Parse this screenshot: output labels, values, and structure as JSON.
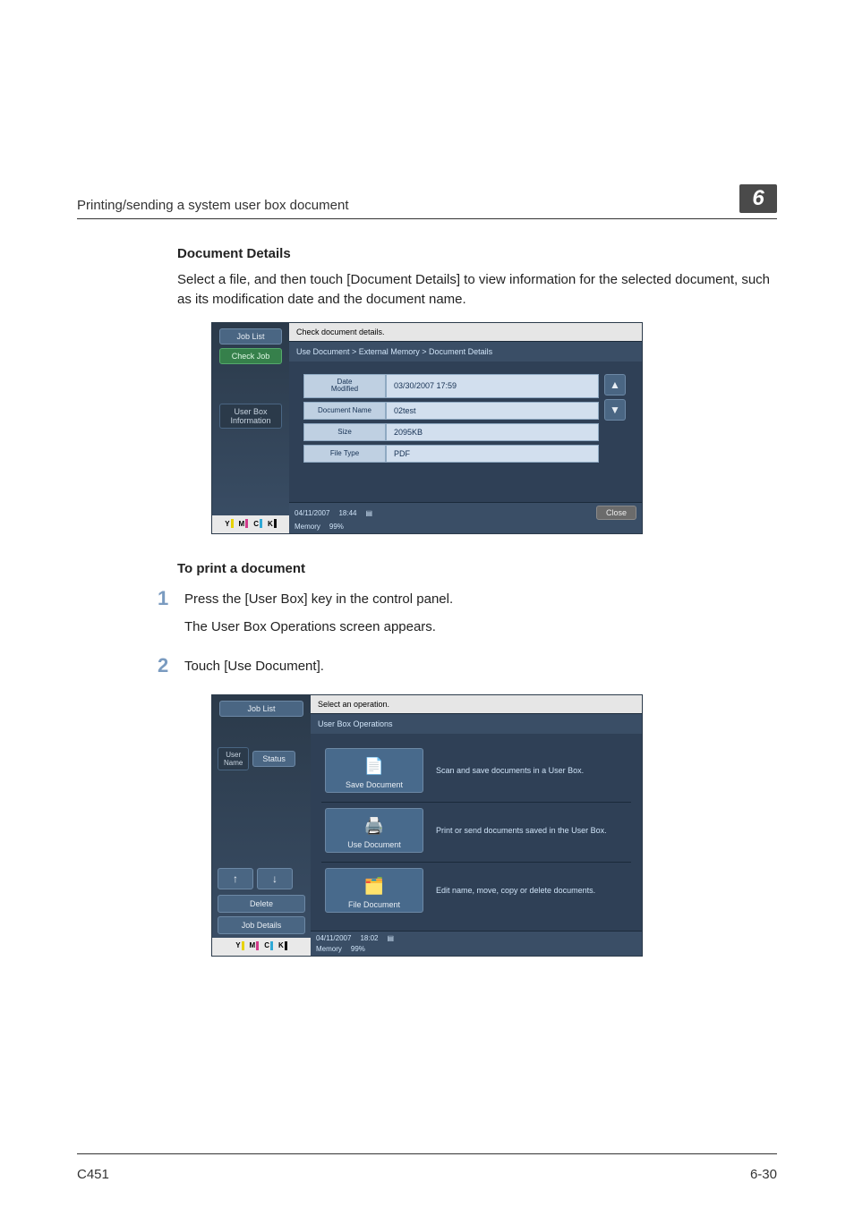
{
  "header": {
    "title": "Printing/sending a system user box document",
    "chapter": "6"
  },
  "section_title": "Document Details",
  "section_para": "Select a file, and then touch [Document Details] to view information for the selected document, such as its modification date and the document name.",
  "ss1": {
    "left": {
      "job_list": "Job List",
      "check_job": "Check Job",
      "user_box_info": "User Box\nInformation"
    },
    "titlebar": "Check document details.",
    "breadcrumb": "Use Document > External Memory > Document Details",
    "fields": [
      {
        "label": "Date\nModified",
        "value": "03/30/2007 17:59"
      },
      {
        "label": "Document Name",
        "value": "02test"
      },
      {
        "label": "Size",
        "value": "2095KB"
      },
      {
        "label": "File Type",
        "value": "PDF"
      }
    ],
    "close": "Close",
    "status": {
      "date": "04/11/2007",
      "time": "18:44",
      "memory_label": "Memory",
      "memory_value": "99%"
    },
    "toner": [
      "Y",
      "M",
      "C",
      "K"
    ]
  },
  "subheading": "To print a document",
  "steps": [
    {
      "num": "1",
      "lines": [
        "Press the [User Box] key in the control panel.",
        "The User Box Operations screen appears."
      ]
    },
    {
      "num": "2",
      "lines": [
        "Touch [Use Document]."
      ]
    }
  ],
  "ss2": {
    "left": {
      "job_list": "Job List",
      "user_name": "User\nName",
      "status": "Status",
      "delete": "Delete",
      "job_details": "Job Details"
    },
    "titlebar": "Select an operation.",
    "subtitle": "User Box Operations",
    "ops": [
      {
        "label": "Save Document",
        "desc": "Scan and save documents in a User Box.",
        "color": "#e0cc40"
      },
      {
        "label": "Use Document",
        "desc": "Print or send documents saved in the User Box.",
        "color": "#5fb0d8"
      },
      {
        "label": "File Document",
        "desc": "Edit name, move, copy or delete documents.",
        "color": "#4fa860"
      }
    ],
    "status": {
      "date": "04/11/2007",
      "time": "18:02",
      "memory_label": "Memory",
      "memory_value": "99%"
    },
    "toner": [
      "Y",
      "M",
      "C",
      "K"
    ]
  },
  "footer": {
    "left": "C451",
    "right": "6-30"
  }
}
